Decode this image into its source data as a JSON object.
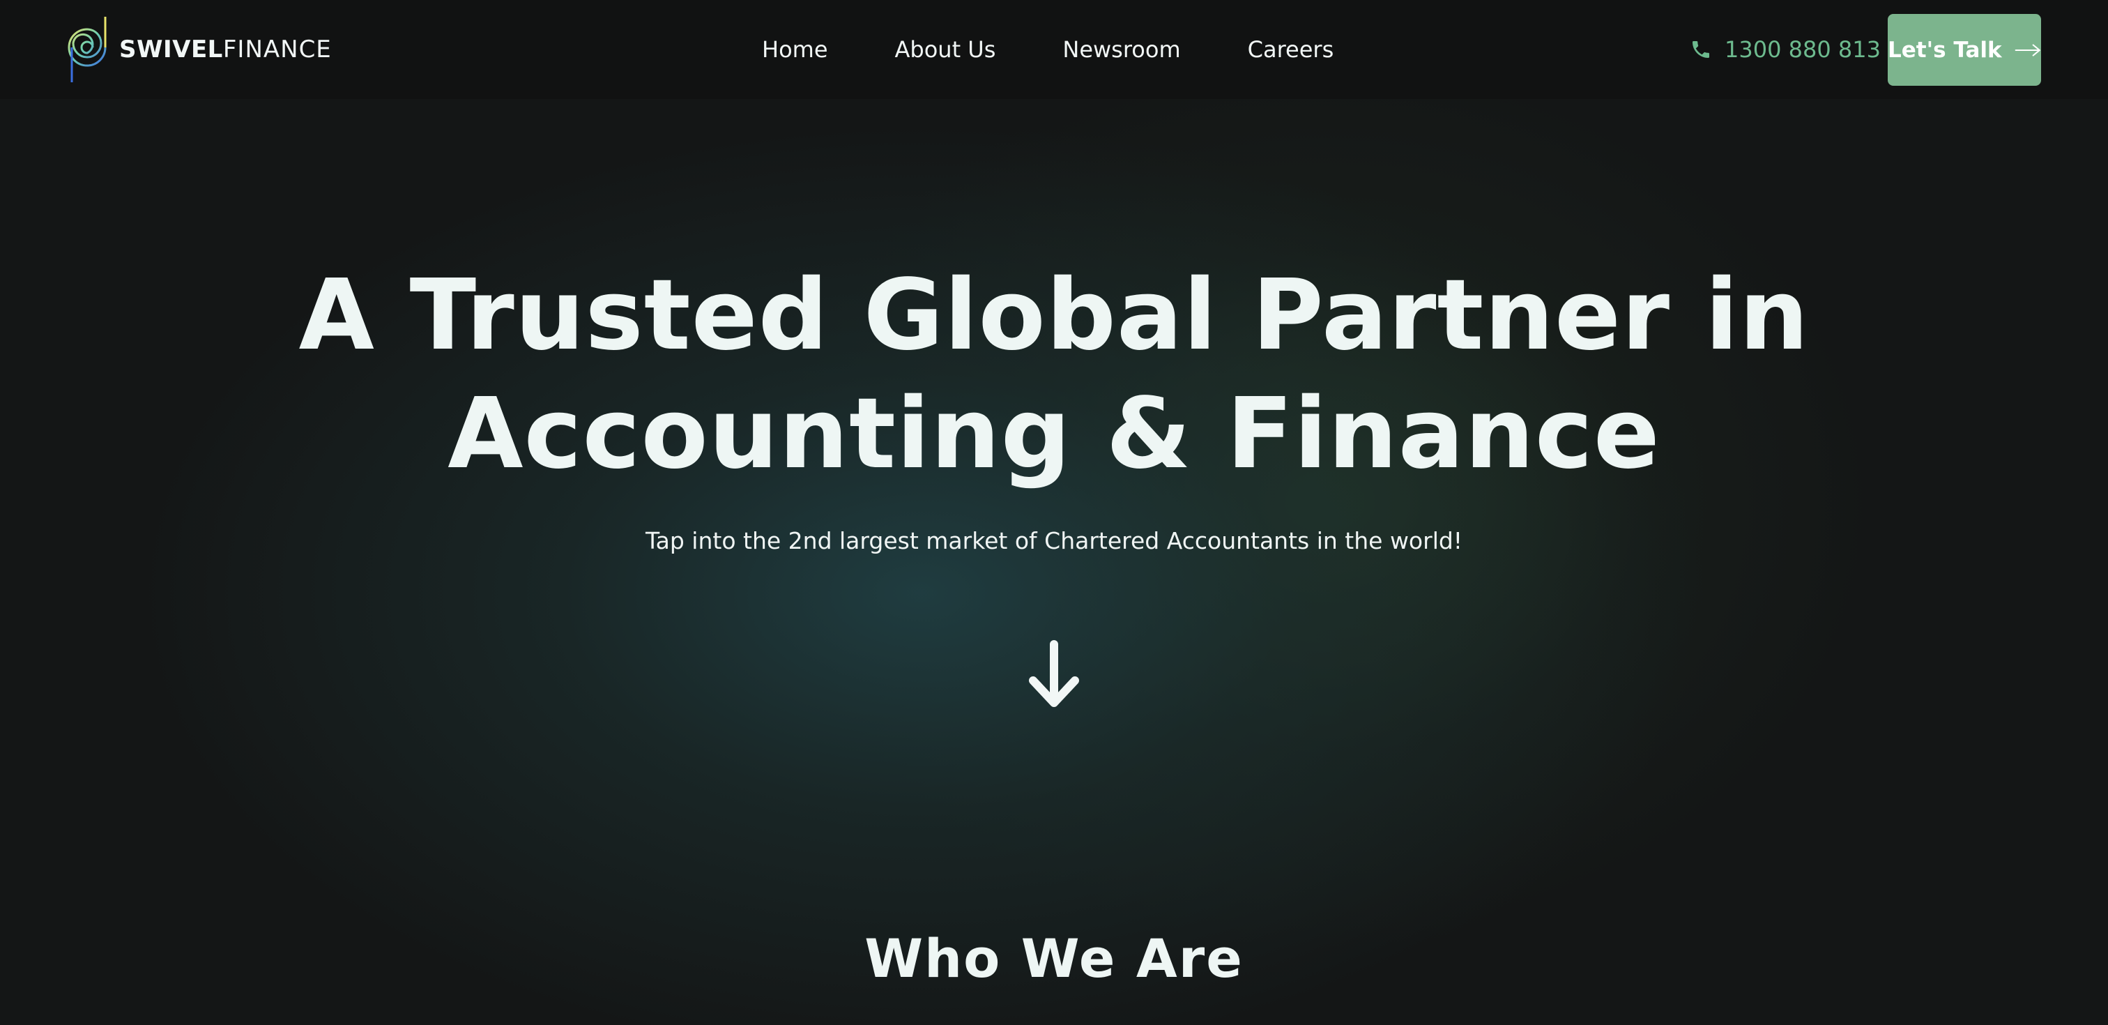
{
  "header": {
    "logo": {
      "icon": "swivel-spiral-logo-icon",
      "name_bold": "SWIVEL",
      "name_light": "FINANCE"
    },
    "nav": [
      {
        "label": "Home"
      },
      {
        "label": "About Us"
      },
      {
        "label": "Newsroom"
      },
      {
        "label": "Careers"
      }
    ],
    "phone": {
      "icon": "phone-icon",
      "number": "1300 880 813"
    },
    "cta": {
      "label": "Let's Talk",
      "icon": "arrow-right-icon"
    }
  },
  "hero": {
    "title_line1": "A Trusted Global Partner in",
    "title_line2": "Accounting & Finance",
    "subtitle": "Tap into the 2nd largest market of Chartered Accountants in the world!",
    "scroll_icon": "arrow-down-icon"
  },
  "sections": {
    "who_we_are": "Who We Are"
  },
  "colors": {
    "nav_bg": "#111212",
    "page_bg": "#141616",
    "accent_green": "#7cb48d",
    "phone_green": "#6dba8e",
    "text": "#eef6f4"
  }
}
